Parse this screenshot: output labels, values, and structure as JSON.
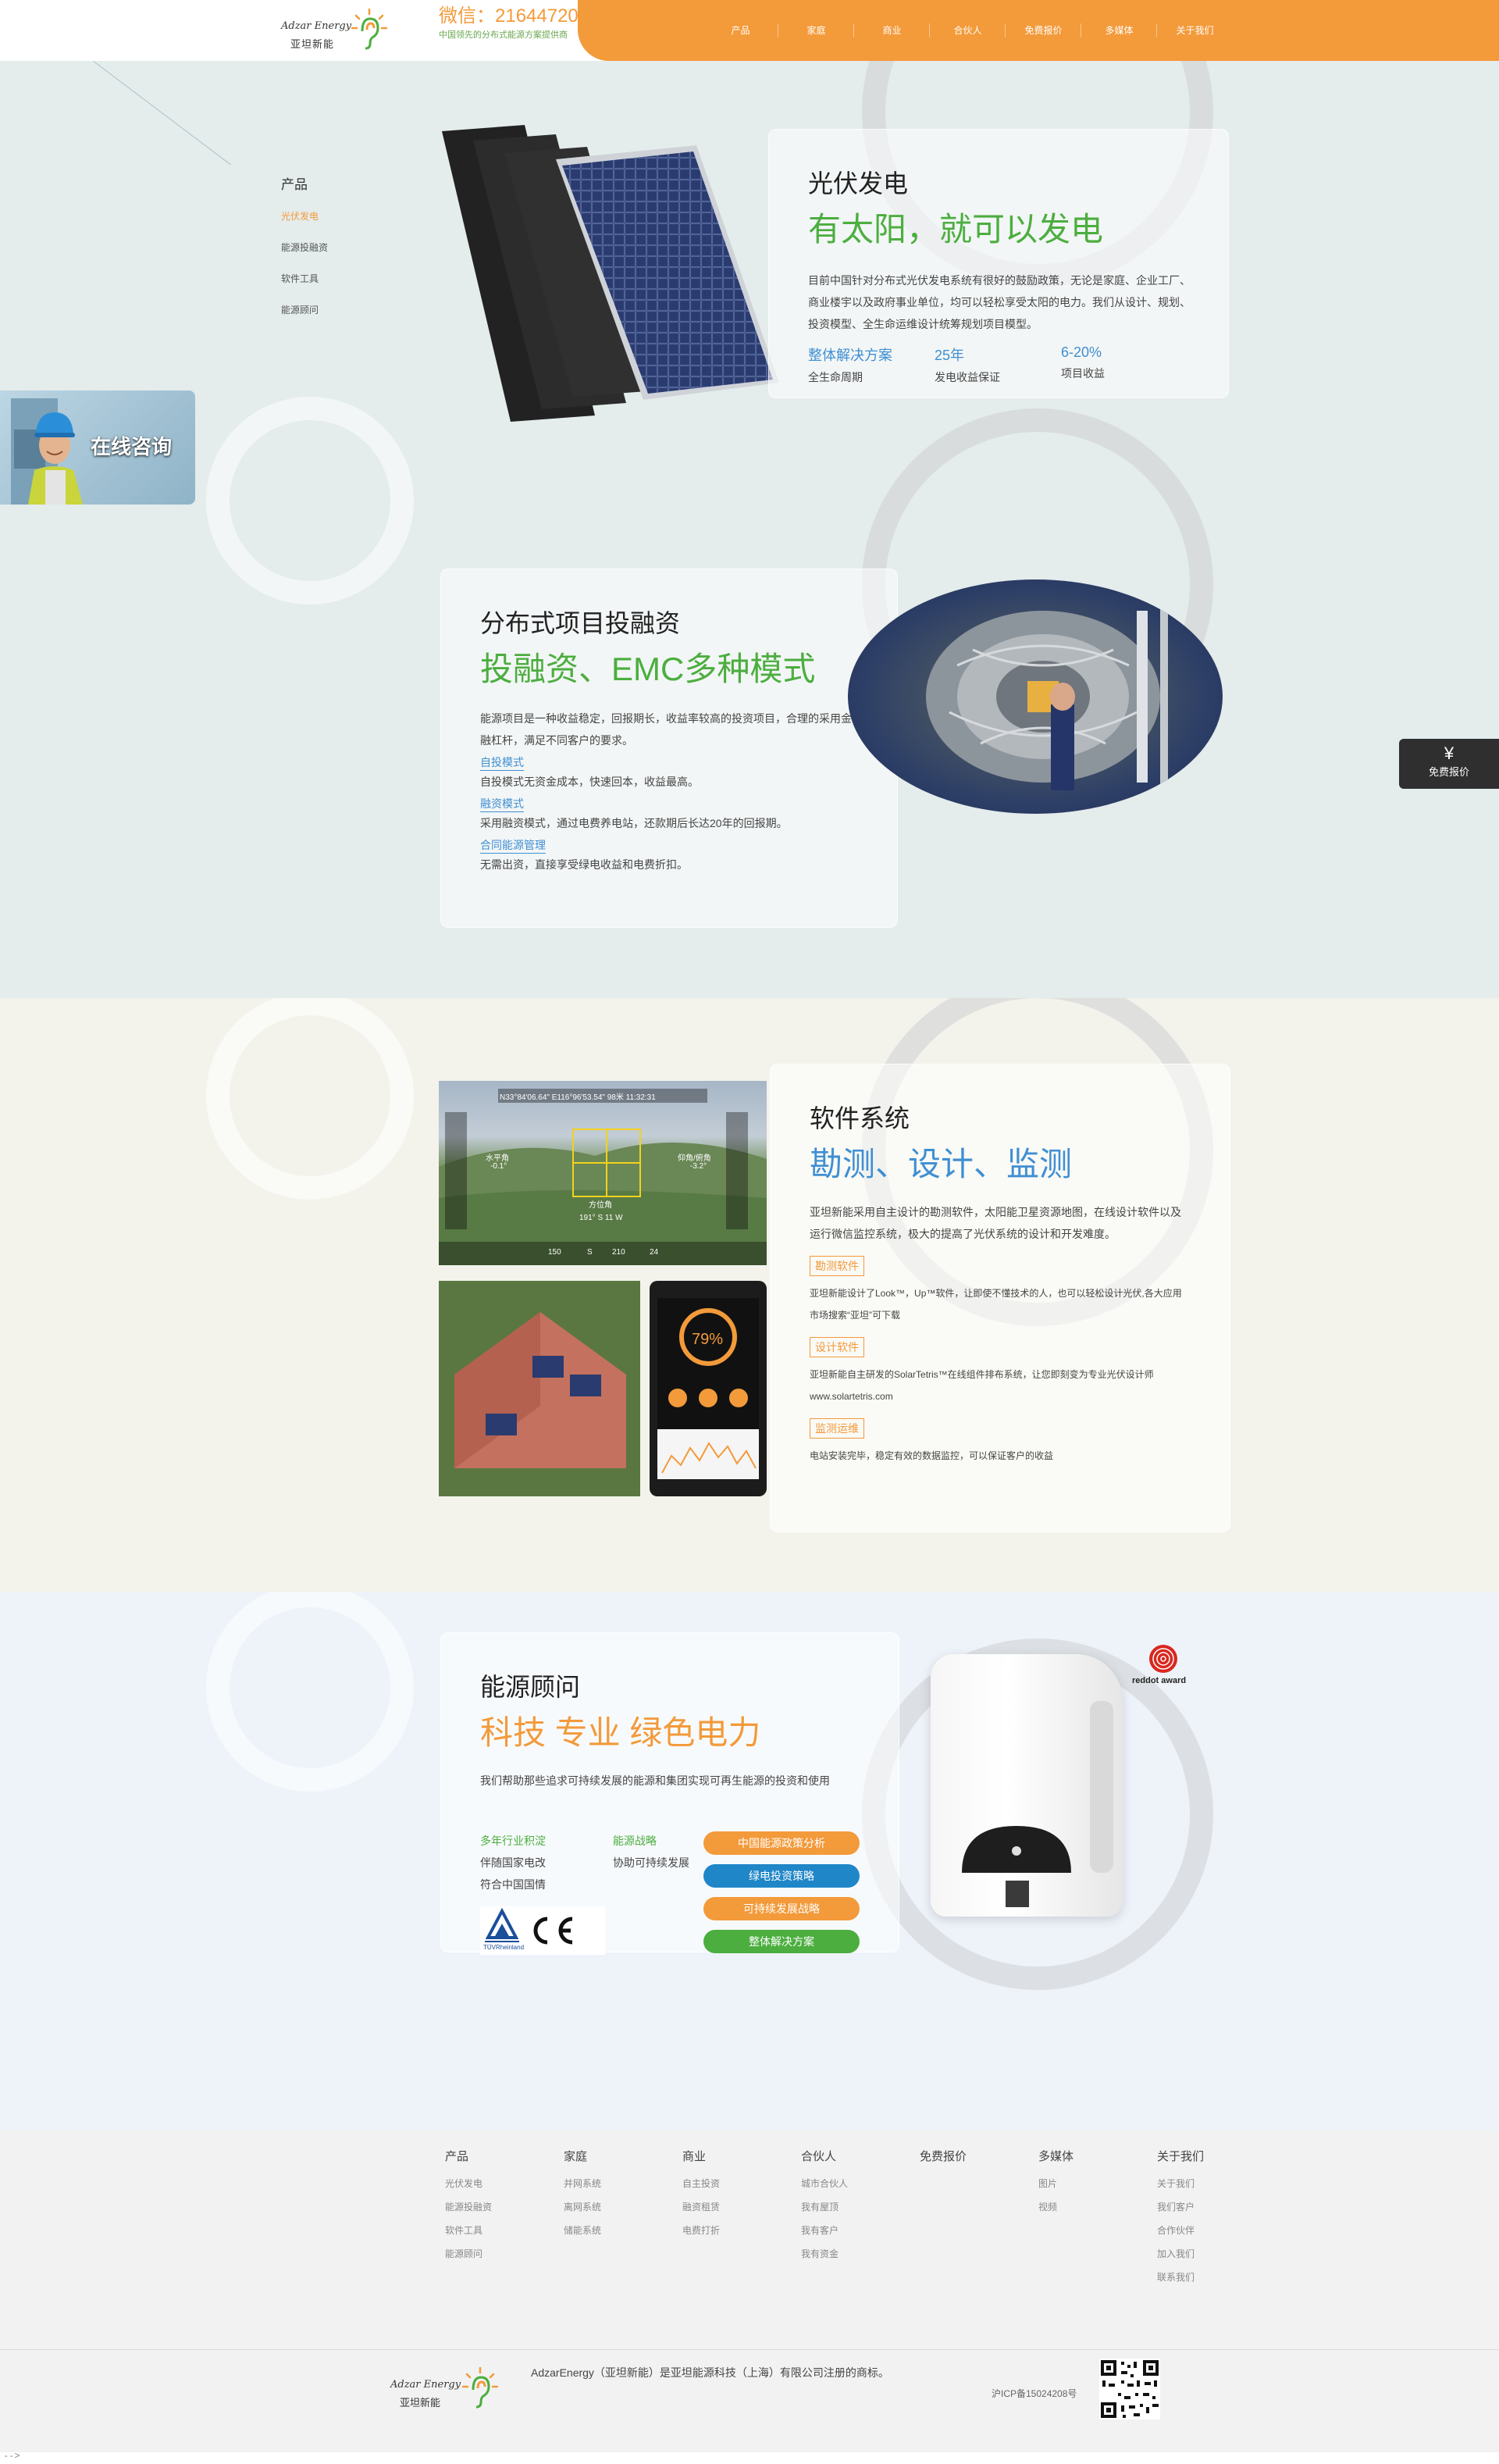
{
  "header": {
    "logo_en": "Adzar Energy",
    "logo_cn": "亚坦新能",
    "wechat": "微信：21644720",
    "wechat_tagline": "中国领先的分布式能源方案提供商",
    "nav": [
      "产品",
      "家庭",
      "商业",
      "合伙人",
      "免费报价",
      "多媒体",
      "关于我们"
    ]
  },
  "sidebar": {
    "title": "产品",
    "items": [
      "光伏发电",
      "能源投融资",
      "软件工具",
      "能源顾问"
    ]
  },
  "consult": {
    "label": "在线咨询"
  },
  "quote": {
    "symbol": "¥",
    "label": "免费报价"
  },
  "pv": {
    "title": "光伏发电",
    "slogan": "有太阳，就可以发电",
    "desc": "目前中国针对分布式光伏发电系统有很好的鼓励政策，无论是家庭、企业工厂、商业楼宇以及政府事业单位，均可以轻松享受太阳的电力。我们从设计、规划、投资模型、全生命运维设计统筹规划项目模型。",
    "stats": [
      {
        "value": "整体解决方案",
        "label": "全生命周期"
      },
      {
        "value": "25年",
        "label": "发电收益保证"
      },
      {
        "value": "6-20%",
        "label": "项目收益"
      }
    ]
  },
  "finance": {
    "title": "分布式项目投融资",
    "slogan": "投融资、EMC多种模式",
    "desc": "能源项目是一种收益稳定，回报期长，收益率较高的投资项目，合理的采用金融杠杆，满足不同客户的要求。",
    "modes": [
      {
        "title": "自投模式",
        "desc": "自投模式无资金成本，快速回本，收益最高。"
      },
      {
        "title": "融资模式",
        "desc": "采用融资模式，通过电费养电站，还款期后长达20年的回报期。"
      },
      {
        "title": "合同能源管理",
        "desc": "无需出资，直接享受绿电收益和电费折扣。"
      }
    ]
  },
  "software": {
    "title": "软件系统",
    "slogan": "勘测、设计、监测",
    "desc": "亚坦新能采用自主设计的勘测软件，太阳能卫星资源地图，在线设计软件以及运行微信监控系统，极大的提高了光伏系统的设计和开发难度。",
    "items": [
      {
        "tag": "勘测软件",
        "desc": "亚坦新能设计了Look™，Up™软件，让即使不懂技术的人，也可以轻松设计光伏,各大应用市场搜索“亚坦”可下载"
      },
      {
        "tag": "设计软件",
        "desc": "亚坦新能自主研发的SolarTetris™在线组件排布系统，让您即刻变为专业光伏设计师www.solartetris.com"
      },
      {
        "tag": "监测运维",
        "desc": "电站安装完毕，稳定有效的数据监控，可以保证客户的收益"
      }
    ],
    "photo_overlay": {
      "coords": "N33°84'06.64\"  E116°96'53.54\"  98米  11:32:31",
      "level_label": "水平角",
      "level_value": "-0.1°",
      "pitch_label": "仰角/俯角",
      "pitch_value": "-3.2°",
      "dir_label": "方位角",
      "dir_value": "191° S 11 W",
      "scale_values": [
        "150",
        "S",
        "210",
        "24"
      ],
      "progress": "79%"
    }
  },
  "energy": {
    "title": "能源顾问",
    "slogan": "科技 专业 绿色电力",
    "desc": "我们帮助那些追求可持续发展的能源和集团实现可再生能源的投资和使用",
    "values": [
      {
        "title": "多年行业积淀",
        "lines": [
          "伴随国家电改",
          "符合中国国情"
        ]
      },
      {
        "title": "能源战略",
        "lines": [
          "协助可持续发展"
        ]
      }
    ],
    "pills": [
      "中国能源政策分析",
      "绿电投资策略",
      "可持续发展战略",
      "整体解决方案"
    ],
    "award": "reddot award",
    "cert_tuv": "TÜVRheinland",
    "cert_ce": "CE"
  },
  "footer": {
    "columns": [
      {
        "title": "产品",
        "items": [
          "光伏发电",
          "能源投融资",
          "软件工具",
          "能源顾问"
        ]
      },
      {
        "title": "家庭",
        "items": [
          "并网系统",
          "离网系统",
          "储能系统"
        ]
      },
      {
        "title": "商业",
        "items": [
          "自主投资",
          "融资租赁",
          "电费打折"
        ]
      },
      {
        "title": "合伙人",
        "items": [
          "城市合伙人",
          "我有屋顶",
          "我有客户",
          "我有资金"
        ]
      },
      {
        "title": "免费报价",
        "items": []
      },
      {
        "title": "多媒体",
        "items": [
          "图片",
          "视频"
        ]
      },
      {
        "title": "关于我们",
        "items": [
          "关于我们",
          "我们客户",
          "合作伙伴",
          "加入我们",
          "联系我们"
        ]
      }
    ],
    "copyright": "AdzarEnergy（亚坦新能）是亚坦能源科技（上海）有限公司注册的商标。",
    "icp": "沪ICP备15024208号"
  },
  "page_end_mark": "-->",
  "colors": {
    "orange": "#f39a3a",
    "green": "#4cae3f",
    "blue": "#3f8fd3",
    "dark": "#2f2f2f"
  }
}
